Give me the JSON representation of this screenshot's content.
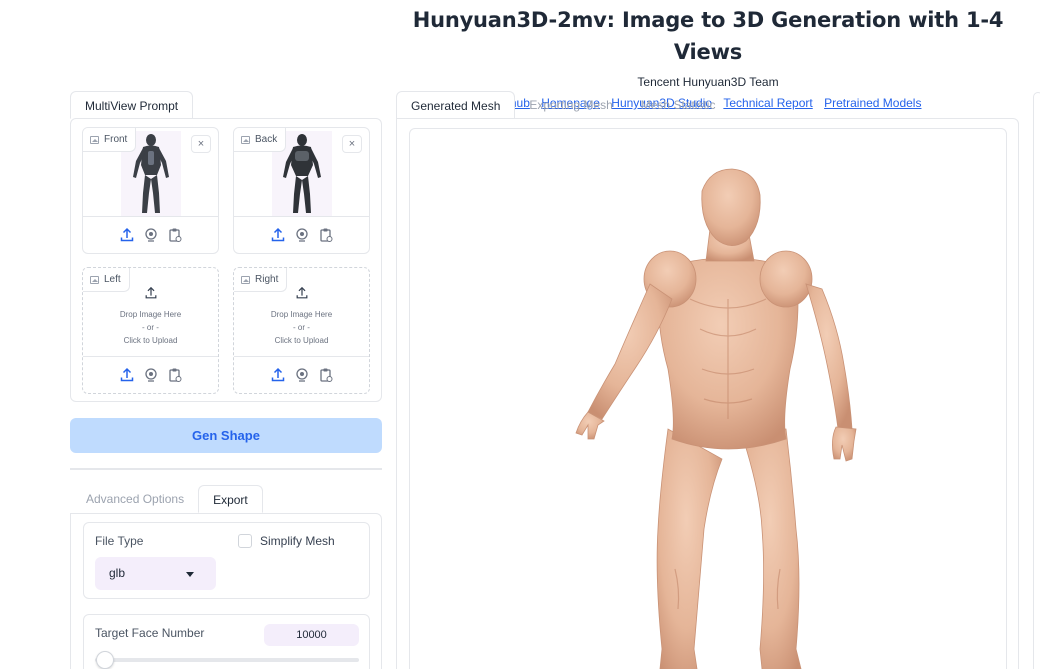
{
  "header": {
    "title": "Hunyuan3D-2mv: Image to 3D Generation with 1-4 Views",
    "subtitle": "Tencent Hunyuan3D Team",
    "links": [
      "Github",
      "Homepage",
      "Hunyuan3D Studio",
      "Technical Report",
      "Pretrained Models"
    ]
  },
  "left": {
    "tab": "MultiView Prompt",
    "slots": [
      {
        "label": "Front",
        "filled": true
      },
      {
        "label": "Back",
        "filled": true
      },
      {
        "label": "Left",
        "filled": false
      },
      {
        "label": "Right",
        "filled": false
      }
    ],
    "close_glyph": "×",
    "drop": {
      "line1": "Drop Image Here",
      "line2": "- or -",
      "line3": "Click to Upload"
    },
    "gen_button": "Gen Shape",
    "option_tabs": [
      "Advanced Options",
      "Export"
    ],
    "active_option_tab": "Export",
    "export": {
      "file_type_label": "File Type",
      "file_type_value": "glb",
      "simplify_label": "Simplify Mesh",
      "simplify_checked": false,
      "target_face_label": "Target Face Number",
      "target_face_value": "10000"
    }
  },
  "right": {
    "tabs": [
      "Generated Mesh",
      "Exporting Mesh",
      "Mesh Statistic"
    ],
    "active_tab": "Generated Mesh"
  },
  "colors": {
    "accent": "#2563eb",
    "gen_button_bg": "#bfdbfe",
    "mesh_skin": "#e8b99d"
  },
  "icons": {
    "upload": "upload-icon",
    "webcam": "webcam-icon",
    "clipboard": "clipboard-icon",
    "image": "image-icon",
    "close": "close-icon"
  }
}
